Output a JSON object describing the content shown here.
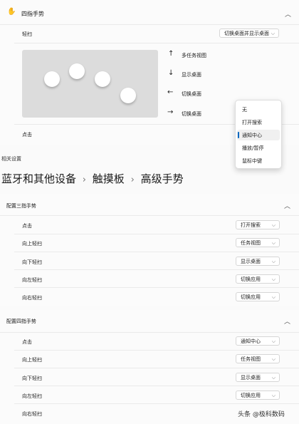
{
  "four_finger": {
    "title": "四指手势",
    "tap_label": "轻扫",
    "swipe_dropdown": "切换桌面并显示桌面",
    "swipe_directions": [
      {
        "icon": "arrow-up-icon",
        "label": "多任务视图"
      },
      {
        "icon": "arrow-down-icon",
        "label": "显示桌面"
      },
      {
        "icon": "arrow-left-icon",
        "label": "切换桌面"
      },
      {
        "icon": "arrow-right-icon",
        "label": "切换桌面"
      }
    ],
    "click_label": "点击",
    "menu_options": [
      "无",
      "打开搜索",
      "通知中心",
      "播放/暂停",
      "鼠标中键"
    ],
    "menu_selected": "通知中心"
  },
  "related_settings": "相关设置",
  "breadcrumb": {
    "part1": "蓝牙和其他设备",
    "part2": "触摸板",
    "part3": "高级手势",
    "separator": "›"
  },
  "three_finger_section": {
    "title": "配置三指手势",
    "rows": [
      {
        "label": "点击",
        "value": "打开搜索"
      },
      {
        "label": "向上轻扫",
        "value": "任务视图"
      },
      {
        "label": "向下轻扫",
        "value": "显示桌面"
      },
      {
        "label": "向左轻扫",
        "value": "切换应用"
      },
      {
        "label": "向右轻扫",
        "value": "切换应用"
      }
    ]
  },
  "four_finger_section": {
    "title": "配置四指手势",
    "rows": [
      {
        "label": "点击",
        "value": "通知中心"
      },
      {
        "label": "向上轻扫",
        "value": "任务视图"
      },
      {
        "label": "向下轻扫",
        "value": "显示桌面"
      },
      {
        "label": "向左轻扫",
        "value": "切换应用"
      },
      {
        "label": "向右轻扫",
        "value": ""
      }
    ]
  },
  "watermark": "头条 @极科数码",
  "colors": {
    "accent": "#0067c0"
  }
}
